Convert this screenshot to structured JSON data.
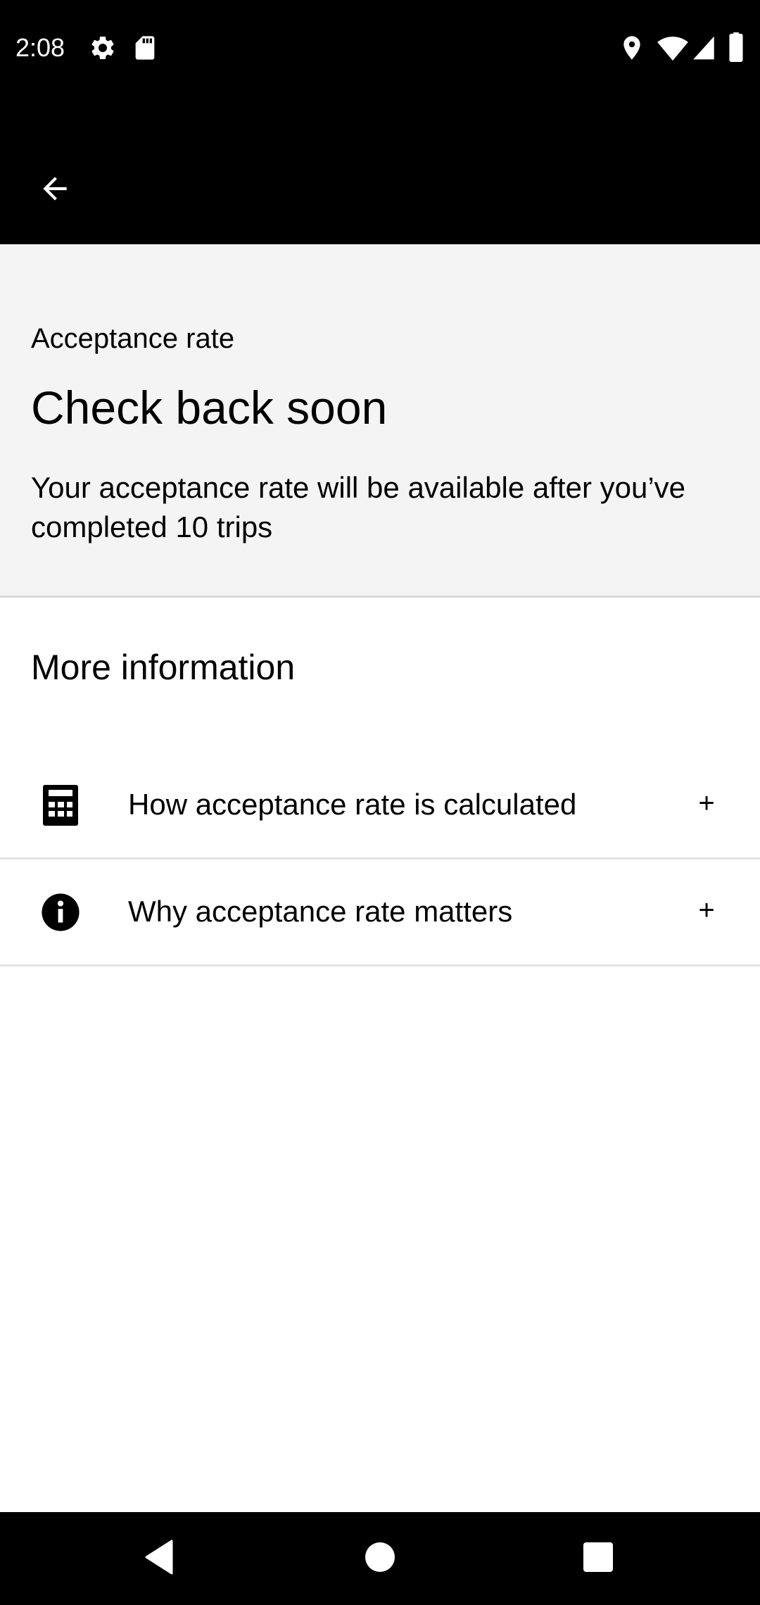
{
  "status_bar": {
    "time": "2:08",
    "icons": [
      "settings-icon",
      "sd-card-icon",
      "location-icon",
      "wifi-icon",
      "signal-icon",
      "battery-icon"
    ]
  },
  "app_bar": {
    "back_icon": "arrow-back-icon"
  },
  "summary": {
    "eyebrow": "Acceptance rate",
    "headline": "Check back soon",
    "description": "Your acceptance rate will be available after you’ve completed 10 trips"
  },
  "more_info": {
    "title": "More information",
    "items": [
      {
        "icon": "calculator-icon",
        "label": "How acceptance rate is calculated",
        "expand": "+"
      },
      {
        "icon": "info-icon",
        "label": "Why acceptance rate matters",
        "expand": "+"
      }
    ]
  },
  "nav_bar": {
    "icons": [
      "nav-back-icon",
      "nav-home-icon",
      "nav-recents-icon"
    ]
  },
  "colors": {
    "bar_background": "#000000",
    "summary_background": "#f4f4f4",
    "divider": "#e2e2e2",
    "text": "#000000"
  }
}
